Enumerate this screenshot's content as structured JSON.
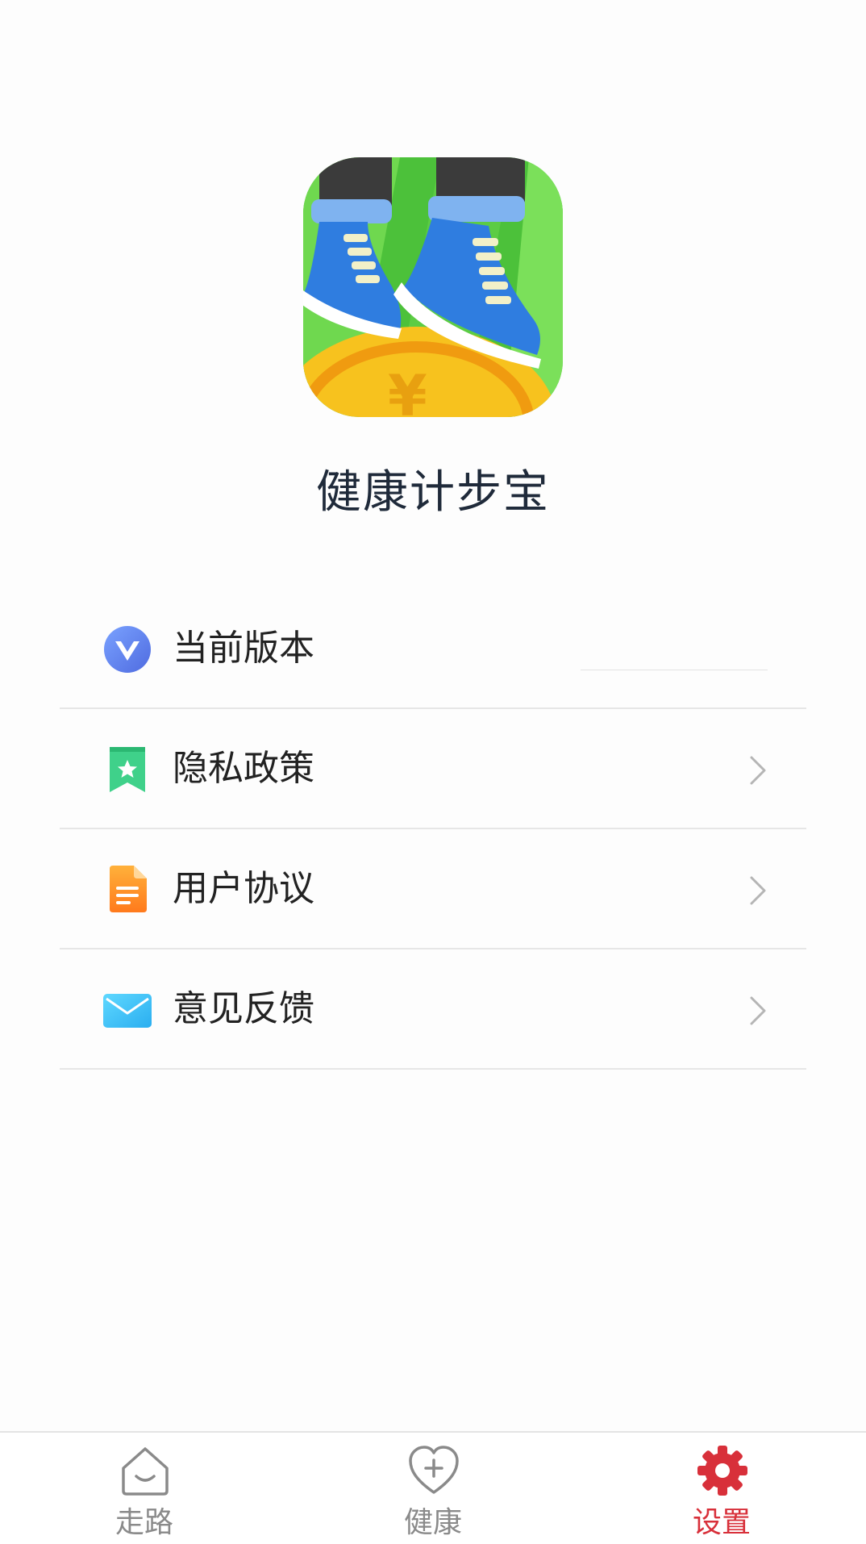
{
  "app": {
    "name": "健康计步宝",
    "logo_icon": "sneakers-on-coin-logo"
  },
  "settings": {
    "items": [
      {
        "label": "当前版本",
        "icon": "version-v-icon",
        "value": ""
      },
      {
        "label": "隐私政策",
        "icon": "bookmark-star-icon"
      },
      {
        "label": "用户协议",
        "icon": "document-icon"
      },
      {
        "label": "意见反馈",
        "icon": "envelope-icon"
      }
    ]
  },
  "bottom_nav": {
    "items": [
      {
        "label": "走路",
        "icon": "house-smile-icon",
        "active": false
      },
      {
        "label": "健康",
        "icon": "heart-plus-icon",
        "active": false
      },
      {
        "label": "设置",
        "icon": "gear-icon",
        "active": true
      }
    ]
  },
  "colors": {
    "accent": "#d8303a",
    "nav_inactive": "#8a8a8a",
    "divider": "#e6e6e6"
  }
}
